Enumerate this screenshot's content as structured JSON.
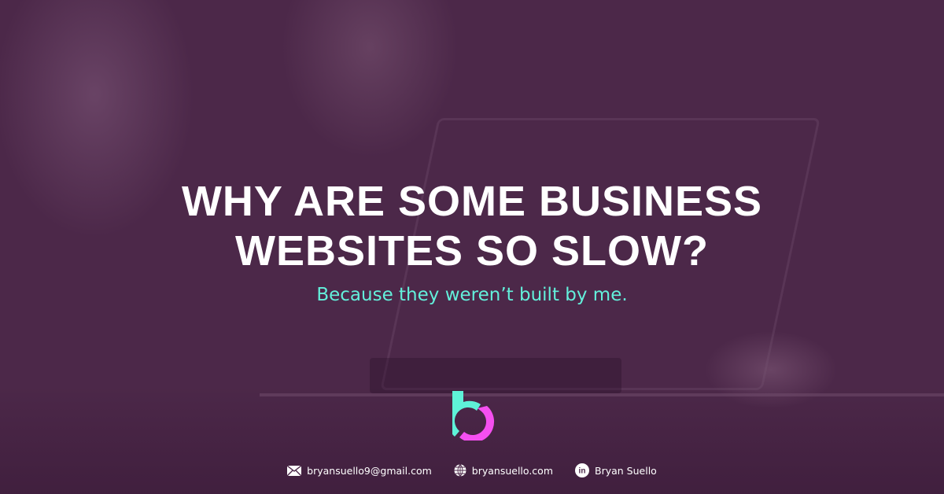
{
  "headline": {
    "line1": "WHY ARE SOME BUSINESS",
    "line2": "WEBSITES SO SLOW?"
  },
  "subtitle": "Because they weren’t built by me.",
  "logo": {
    "letter": "b",
    "colors": {
      "cyan": "#5ef2d8",
      "magenta": "#f54ff0"
    }
  },
  "footer": [
    {
      "icon": "envelope-icon",
      "text": "bryansuello9@gmail.com"
    },
    {
      "icon": "globe-icon",
      "text": "bryansuello.com"
    },
    {
      "icon": "linkedin-icon",
      "text": "Bryan Suello"
    }
  ],
  "colors": {
    "background": "#4c2849",
    "headline": "#ffffff",
    "subtitle": "#63f0db"
  }
}
